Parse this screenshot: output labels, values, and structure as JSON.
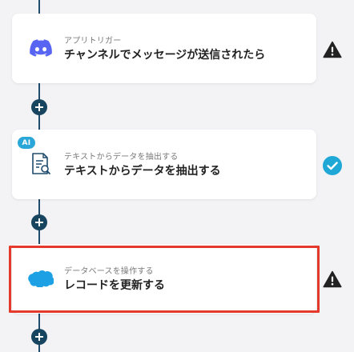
{
  "flow": {
    "steps": [
      {
        "subtitle": "アプリトリガー",
        "title": "チャンネルでメッセージが送信されたら",
        "icon": "discord-icon",
        "status": "warning-icon"
      },
      {
        "subtitle": "テキストからデータを抽出する",
        "title": "テキストからデータを抽出する",
        "icon": "document-search-icon",
        "badge": "AI",
        "status": "check-icon"
      },
      {
        "subtitle": "データベースを操作する",
        "title": "レコードを更新する",
        "icon": "salesforce-cloud-icon",
        "status": "warning-icon",
        "highlighted": true
      }
    ]
  },
  "colors": {
    "background": "#f3f3f6",
    "connector": "#1f4b6d",
    "add_button": "#17445f",
    "discord": "#5865f2",
    "ai_badge": "#2aa7d8",
    "check": "#1fa8d6",
    "warning": "#222222",
    "highlight": "#e53a2b",
    "salesforce": "#1da1e4"
  }
}
